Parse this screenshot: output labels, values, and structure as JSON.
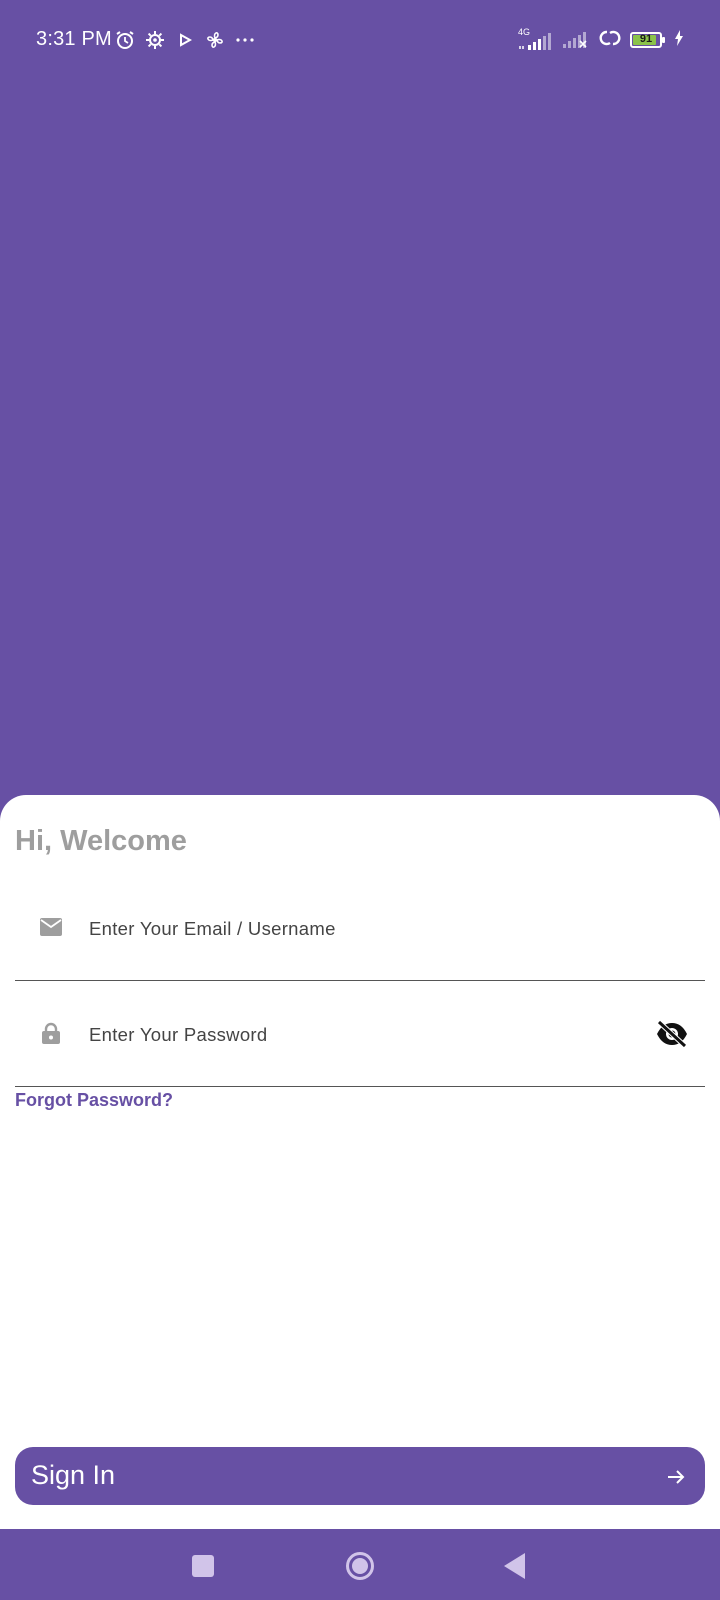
{
  "status_bar": {
    "time": "3:31 PM",
    "network_label": "4G",
    "battery_level": "91",
    "icons": [
      "alarm-icon",
      "settings-gear-icon",
      "play-icon",
      "fan-icon",
      "more-dots-icon",
      "signal-icon",
      "signal-off-icon",
      "link-icon",
      "battery-icon",
      "charging-icon"
    ]
  },
  "login": {
    "title": "Hi, Welcome",
    "email_placeholder": "Enter Your Email / Username",
    "password_placeholder": "Enter Your Password",
    "forgot_password": "Forgot Password?",
    "sign_in": "Sign In"
  },
  "nav_bar": {
    "buttons": [
      "recents-square-icon",
      "home-circle-icon",
      "back-triangle-icon"
    ]
  },
  "colors": {
    "primary": "#6750A4",
    "title_gray": "#9E9E9E",
    "battery_green": "#8BC34A"
  }
}
